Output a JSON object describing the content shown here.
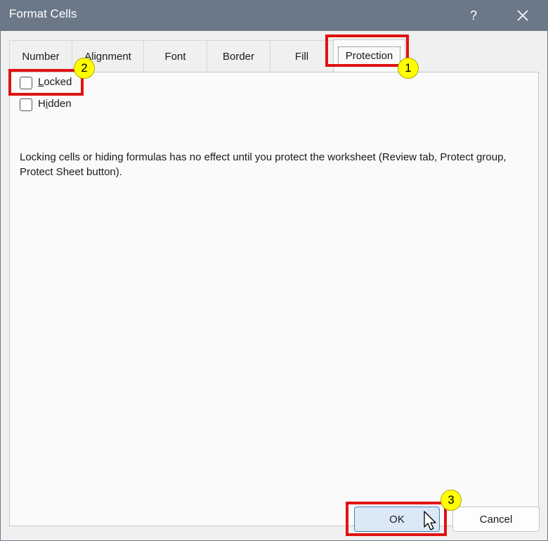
{
  "window": {
    "title": "Format Cells",
    "help_label": "?"
  },
  "tabs": [
    {
      "label": "Number"
    },
    {
      "label": "Alignment"
    },
    {
      "label": "Font"
    },
    {
      "label": "Border"
    },
    {
      "label": "Fill"
    },
    {
      "label": "Protection",
      "active": true
    }
  ],
  "protection": {
    "locked": {
      "access_key": "L",
      "rest": "ocked",
      "checked": false
    },
    "hidden": {
      "pre": "H",
      "access_key": "i",
      "rest": "dden",
      "checked": false
    },
    "note": "Locking cells or hiding formulas has no effect until you protect the worksheet (Review tab, Protect group, Protect Sheet button)."
  },
  "buttons": {
    "ok": "OK",
    "cancel": "Cancel"
  },
  "callouts": {
    "one": "1",
    "two": "2",
    "three": "3"
  },
  "colors": {
    "titlebar": "#6b7888",
    "highlight": "#e01313",
    "badge": "#ffff00",
    "ok_button": "#dbe8f6"
  }
}
